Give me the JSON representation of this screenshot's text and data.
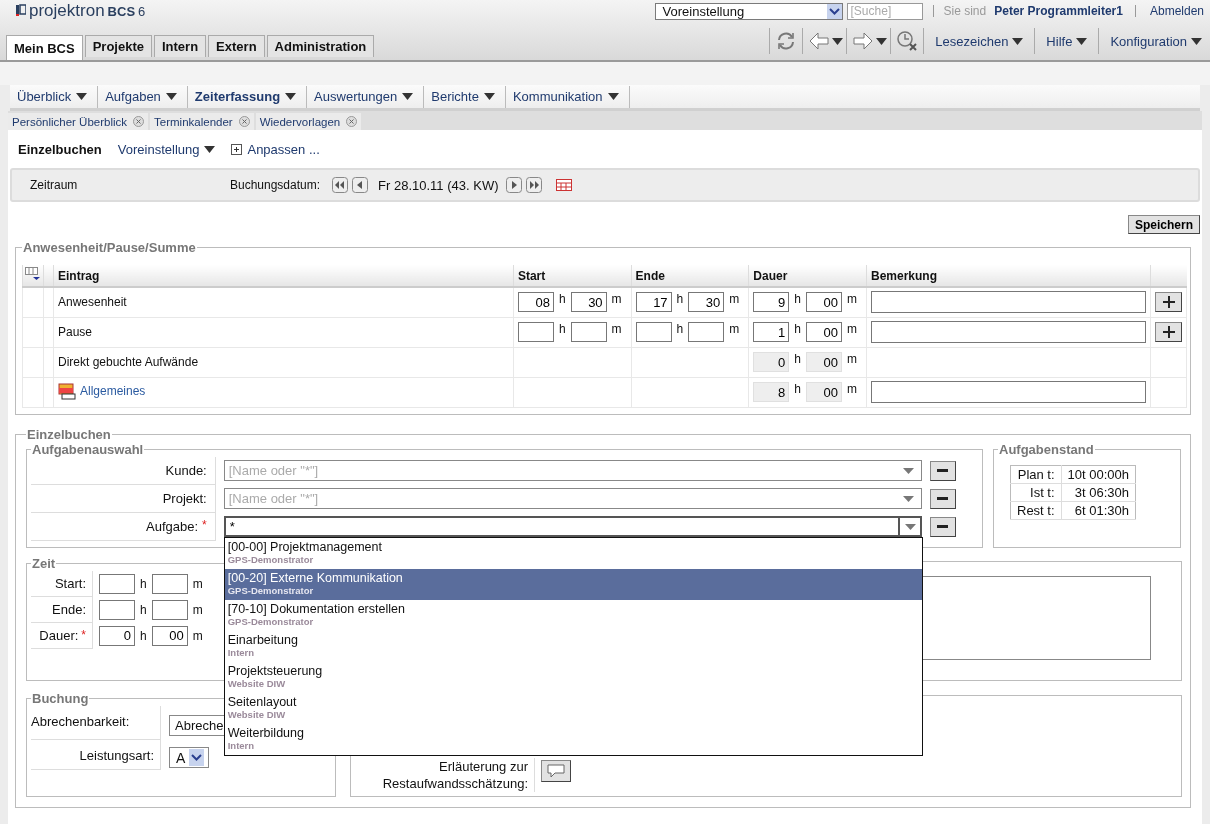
{
  "header": {
    "logo": "projektron",
    "logo_product": "BCS",
    "logo_version": "6",
    "preset_select": "Voreinstellung",
    "search": {
      "placeholder": "[Suche]"
    },
    "user_prefix": "Sie sind",
    "user": "Peter Programmleiter1",
    "logout": "Abmelden"
  },
  "main_tabs": [
    {
      "label": "Mein BCS",
      "selected": true
    },
    {
      "label": "Projekte",
      "selected": false
    },
    {
      "label": "Intern",
      "selected": false
    },
    {
      "label": "Extern",
      "selected": false
    },
    {
      "label": "Administration",
      "selected": false
    }
  ],
  "toolbar_menus": [
    "Lesezeichen",
    "Hilfe",
    "Konfiguration"
  ],
  "menu": [
    {
      "label": "Überblick",
      "selected": false
    },
    {
      "label": "Aufgaben",
      "selected": false
    },
    {
      "label": "Zeiterfassung",
      "selected": true
    },
    {
      "label": "Auswertungen",
      "selected": false
    },
    {
      "label": "Berichte",
      "selected": false
    },
    {
      "label": "Kommunikation",
      "selected": false
    }
  ],
  "open_tabs": [
    "Persönlicher Überblick",
    "Terminkalender",
    "Wiedervorlagen"
  ],
  "view": {
    "title": "Einzelbuchen",
    "preset": "Voreinstellung",
    "customize": "Anpassen ..."
  },
  "period": {
    "label": "Zeitraum",
    "date_label": "Buchungsdatum:",
    "date": "Fr 28.10.11 (43. KW)"
  },
  "save": "Speichern",
  "attendance": {
    "title": "Anwesenheit/Pause/Summe",
    "columns": [
      "Eintrag",
      "Start",
      "Ende",
      "Dauer",
      "Bemerkung"
    ],
    "rows": [
      {
        "kind": "plain",
        "entry": "Anwesenheit",
        "start": {
          "hours": "08",
          "minutes": "30",
          "units": [
            "h",
            "m"
          ]
        },
        "end": {
          "hours": "17",
          "minutes": "30",
          "units": [
            "h",
            "m"
          ]
        },
        "duration": {
          "hours": "9",
          "minutes": "00",
          "units": [
            "h",
            "m"
          ],
          "readonly": false
        },
        "remark_field": true,
        "add_button": true
      },
      {
        "kind": "plain",
        "entry": "Pause",
        "start": {
          "units": [
            "h",
            "m"
          ]
        },
        "end": {
          "units": [
            "h",
            "m"
          ]
        },
        "duration": {
          "hours": "1",
          "minutes": "00",
          "units": [
            "h",
            "m"
          ],
          "readonly": false
        },
        "remark_field": true,
        "add_button": true
      },
      {
        "kind": "plain",
        "entry": "Direkt gebuchte Aufwände",
        "duration": {
          "hours": "0",
          "minutes": "00",
          "units": [
            "h",
            "m"
          ],
          "readonly": true
        },
        "remark_field": false,
        "add_button": false
      },
      {
        "kind": "link",
        "entry": "Allgemeines",
        "duration": {
          "hours": "8",
          "minutes": "00",
          "units": [
            "h",
            "m"
          ],
          "readonly": true
        },
        "remark_field": true,
        "add_button": false
      }
    ]
  },
  "booking": {
    "title": "Einzelbuchen",
    "task_selection": {
      "title": "Aufgabenauswahl",
      "fields": [
        {
          "label": "Kunde:",
          "placeholder": "[Name oder \"*\"]",
          "open": false
        },
        {
          "label": "Projekt:",
          "placeholder": "[Name oder \"*\"]",
          "open": false
        },
        {
          "label": "Aufgabe:",
          "required_mark": "*",
          "value": "*",
          "open": true
        }
      ]
    },
    "task_status": {
      "title": "Aufgabenstand",
      "rows": [
        {
          "label": "Plan t:",
          "value": "10t 00:00h"
        },
        {
          "label": "Ist t:",
          "value": "3t 06:30h"
        },
        {
          "label": "Rest t:",
          "value": "6t 01:30h"
        }
      ]
    },
    "time": {
      "title": "Zeit",
      "rows": [
        {
          "label": "Start:",
          "units": [
            "h",
            "m"
          ]
        },
        {
          "label": "Ende:",
          "units": [
            "h",
            "m"
          ]
        },
        {
          "label": "Dauer:",
          "required_mark": "*",
          "hours": "0",
          "minutes": "00",
          "units": [
            "h",
            "m"
          ]
        }
      ]
    },
    "posting": {
      "title": "Buchung",
      "rows": [
        {
          "label": "Abrechenbarkeit:",
          "value": "Abreche",
          "kind": "wide"
        },
        {
          "label": "Leistungsart:",
          "value": "A",
          "kind": "small"
        }
      ]
    },
    "estimate_note": {
      "label": "Erläuterung zur Restaufwandsschätzung:"
    },
    "task_options": [
      {
        "title": "[00-00] Projektmanagement",
        "subtitle": "GPS-Demonstrator",
        "selected": false
      },
      {
        "title": "[00-20] Externe Kommunikation",
        "subtitle": "GPS-Demonstrator",
        "selected": true
      },
      {
        "title": "[70-10] Dokumentation erstellen",
        "subtitle": "GPS-Demonstrator",
        "selected": false
      },
      {
        "title": "Einarbeitung",
        "subtitle": "Intern",
        "selected": false
      },
      {
        "title": "Projektsteuerung",
        "subtitle": "Website DIW",
        "selected": false
      },
      {
        "title": "Seitenlayout",
        "subtitle": "Website DIW",
        "selected": false
      },
      {
        "title": "Weiterbildung",
        "subtitle": "Intern",
        "selected": false
      }
    ]
  }
}
